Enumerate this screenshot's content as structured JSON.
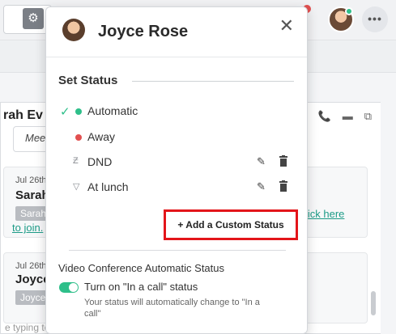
{
  "background": {
    "chat_partner": "rah Ev",
    "meeting_placeholder": "Mee",
    "messages": [
      {
        "date": "Jul 26th",
        "name": "Sarah",
        "tag": "Sarah",
        "join_text": "to join.",
        "link_text": "lick here"
      },
      {
        "date": "Jul 26th",
        "name": "Joyce",
        "tag": "Joyce"
      }
    ],
    "compose_placeholder": "e typing to enter a message, or press / for more options"
  },
  "popup": {
    "user_name": "Joyce Rose",
    "close_label": "✕",
    "set_status_label": "Set Status",
    "statuses": [
      {
        "label": "Automatic",
        "selected": true,
        "icon": "green-dot",
        "color": "#2ebf8a",
        "editable": false
      },
      {
        "label": "Away",
        "selected": false,
        "icon": "red-dot",
        "color": "#e25050",
        "editable": false
      },
      {
        "label": "DND",
        "selected": false,
        "icon": "dnd-icon",
        "editable": true
      },
      {
        "label": "At lunch",
        "selected": false,
        "icon": "lunch-icon",
        "editable": true
      }
    ],
    "add_custom_status_label": "+ Add a Custom Status",
    "video_conference_label": "Video Conference Automatic Status",
    "toggle_label": "Turn on \"In a call\" status",
    "toggle_on": true,
    "toggle_help": "Your status will automatically change to \"In a call\""
  },
  "colors": {
    "accent": "#2ebf8a",
    "highlight": "#e3151a",
    "away": "#e25050"
  }
}
